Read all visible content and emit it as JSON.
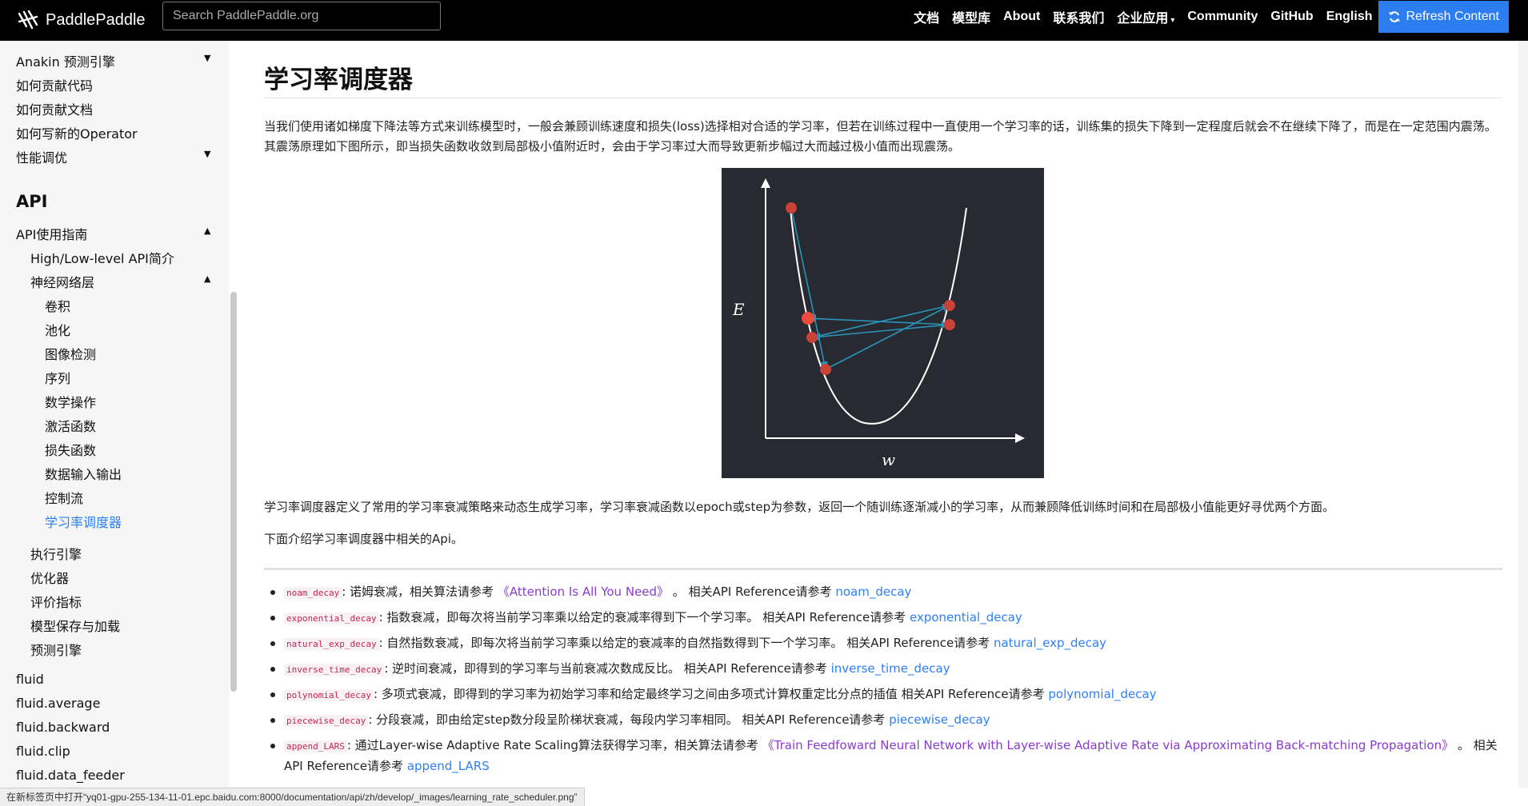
{
  "header": {
    "logo_text": "PaddlePaddle",
    "search_placeholder": "Search PaddlePaddle.org",
    "nav": [
      "文档",
      "模型库",
      "About",
      "联系我们",
      "企业应用",
      "Community",
      "GitHub",
      "English"
    ],
    "refresh_label": "Refresh Content"
  },
  "sidebar": {
    "items_top": [
      "Anakin 预测引擎",
      "如何贡献代码",
      "如何贡献文档",
      "如何写新的Operator",
      "性能调优"
    ],
    "api_heading": "API",
    "api_guide": "API使用指南",
    "hl_intro": "High/Low-level API简介",
    "nn": "神经网络层",
    "nn_children": [
      "卷积",
      "池化",
      "图像检测",
      "序列",
      "数学操作",
      "激活函数",
      "损失函数",
      "数据输入输出",
      "控制流",
      "学习率调度器"
    ],
    "after_nn": [
      "执行引擎",
      "优化器",
      "评价指标",
      "模型保存与加载",
      "预测引擎"
    ],
    "fluid": [
      "fluid",
      "fluid.average",
      "fluid.backward",
      "fluid.clip",
      "fluid.data_feeder"
    ]
  },
  "content": {
    "title": "学习率调度器",
    "para1": "当我们使用诸如梯度下降法等方式来训练模型时，一般会兼顾训练速度和损失(loss)选择相对合适的学习率，但若在训练过程中一直使用一个学习率的话，训练集的损失下降到一定程度后就会不在继续下降了，而是在一定范围内震荡。其震荡原理如下图所示，即当损失函数收敛到局部极小值附近时，会由于学习率过大而导致更新步幅过大而越过极小值而出现震荡。",
    "figure": {
      "ylabel": "E",
      "xlabel": "w"
    },
    "para2": "学习率调度器定义了常用的学习率衰减策略来动态生成学习率，学习率衰减函数以epoch或step为参数，返回一个随训练逐渐减小的学习率，从而兼顾降低训练时间和在局部极小值能更好寻优两个方面。",
    "para3": "下面介绍学习率调度器中相关的Api。",
    "api_items": [
      {
        "code": "noam_decay",
        "text": ": 诺姆衰减，相关算法请参考 ",
        "ref": "《Attention Is All You Need》",
        "mid": " 。 相关API Reference请参考 ",
        "link": "noam_decay"
      },
      {
        "code": "exponential_decay",
        "text": ": 指数衰减，即每次将当前学习率乘以给定的衰减率得到下一个学习率。 相关API Reference请参考 ",
        "ref": "",
        "mid": "",
        "link": "exponential_decay"
      },
      {
        "code": "natural_exp_decay",
        "text": ": 自然指数衰减，即每次将当前学习率乘以给定的衰减率的自然指数得到下一个学习率。 相关API Reference请参考 ",
        "ref": "",
        "mid": "",
        "link": "natural_exp_decay"
      },
      {
        "code": "inverse_time_decay",
        "text": ": 逆时间衰减，即得到的学习率与当前衰减次数成反比。 相关API Reference请参考 ",
        "ref": "",
        "mid": "",
        "link": "inverse_time_decay"
      },
      {
        "code": "polynomial_decay",
        "text": ": 多项式衰减，即得到的学习率为初始学习率和给定最终学习之间由多项式计算权重定比分点的插值 相关API Reference请参考 ",
        "ref": "",
        "mid": "",
        "link": "polynomial_decay"
      },
      {
        "code": "piecewise_decay",
        "text": ": 分段衰减，即由给定step数分段呈阶梯状衰减，每段内学习率相同。 相关API Reference请参考 ",
        "ref": "",
        "mid": "",
        "link": "piecewise_decay"
      },
      {
        "code": "append_LARS",
        "text": ": 通过Layer-wise Adaptive Rate Scaling算法获得学习率，相关算法请参考 ",
        "ref": "《Train Feedfoward Neural Network with Layer-wise Adaptive Rate via Approximating Back-matching Propagation》",
        "mid": " 。 相关API Reference请参考 ",
        "link": "append_LARS"
      }
    ]
  },
  "statusbar": "在新标签页中打开“yq01-gpu-255-134-11-01.epc.baidu.com:8000/documentation/api/zh/develop/_images/learning_rate_scheduler.png”",
  "colors": {
    "accent": "#2d7ff9",
    "refresh_bg": "#2b7df0",
    "figure_bg": "#272a31",
    "point": "#e24b3b",
    "arrow": "#2a93b8"
  }
}
